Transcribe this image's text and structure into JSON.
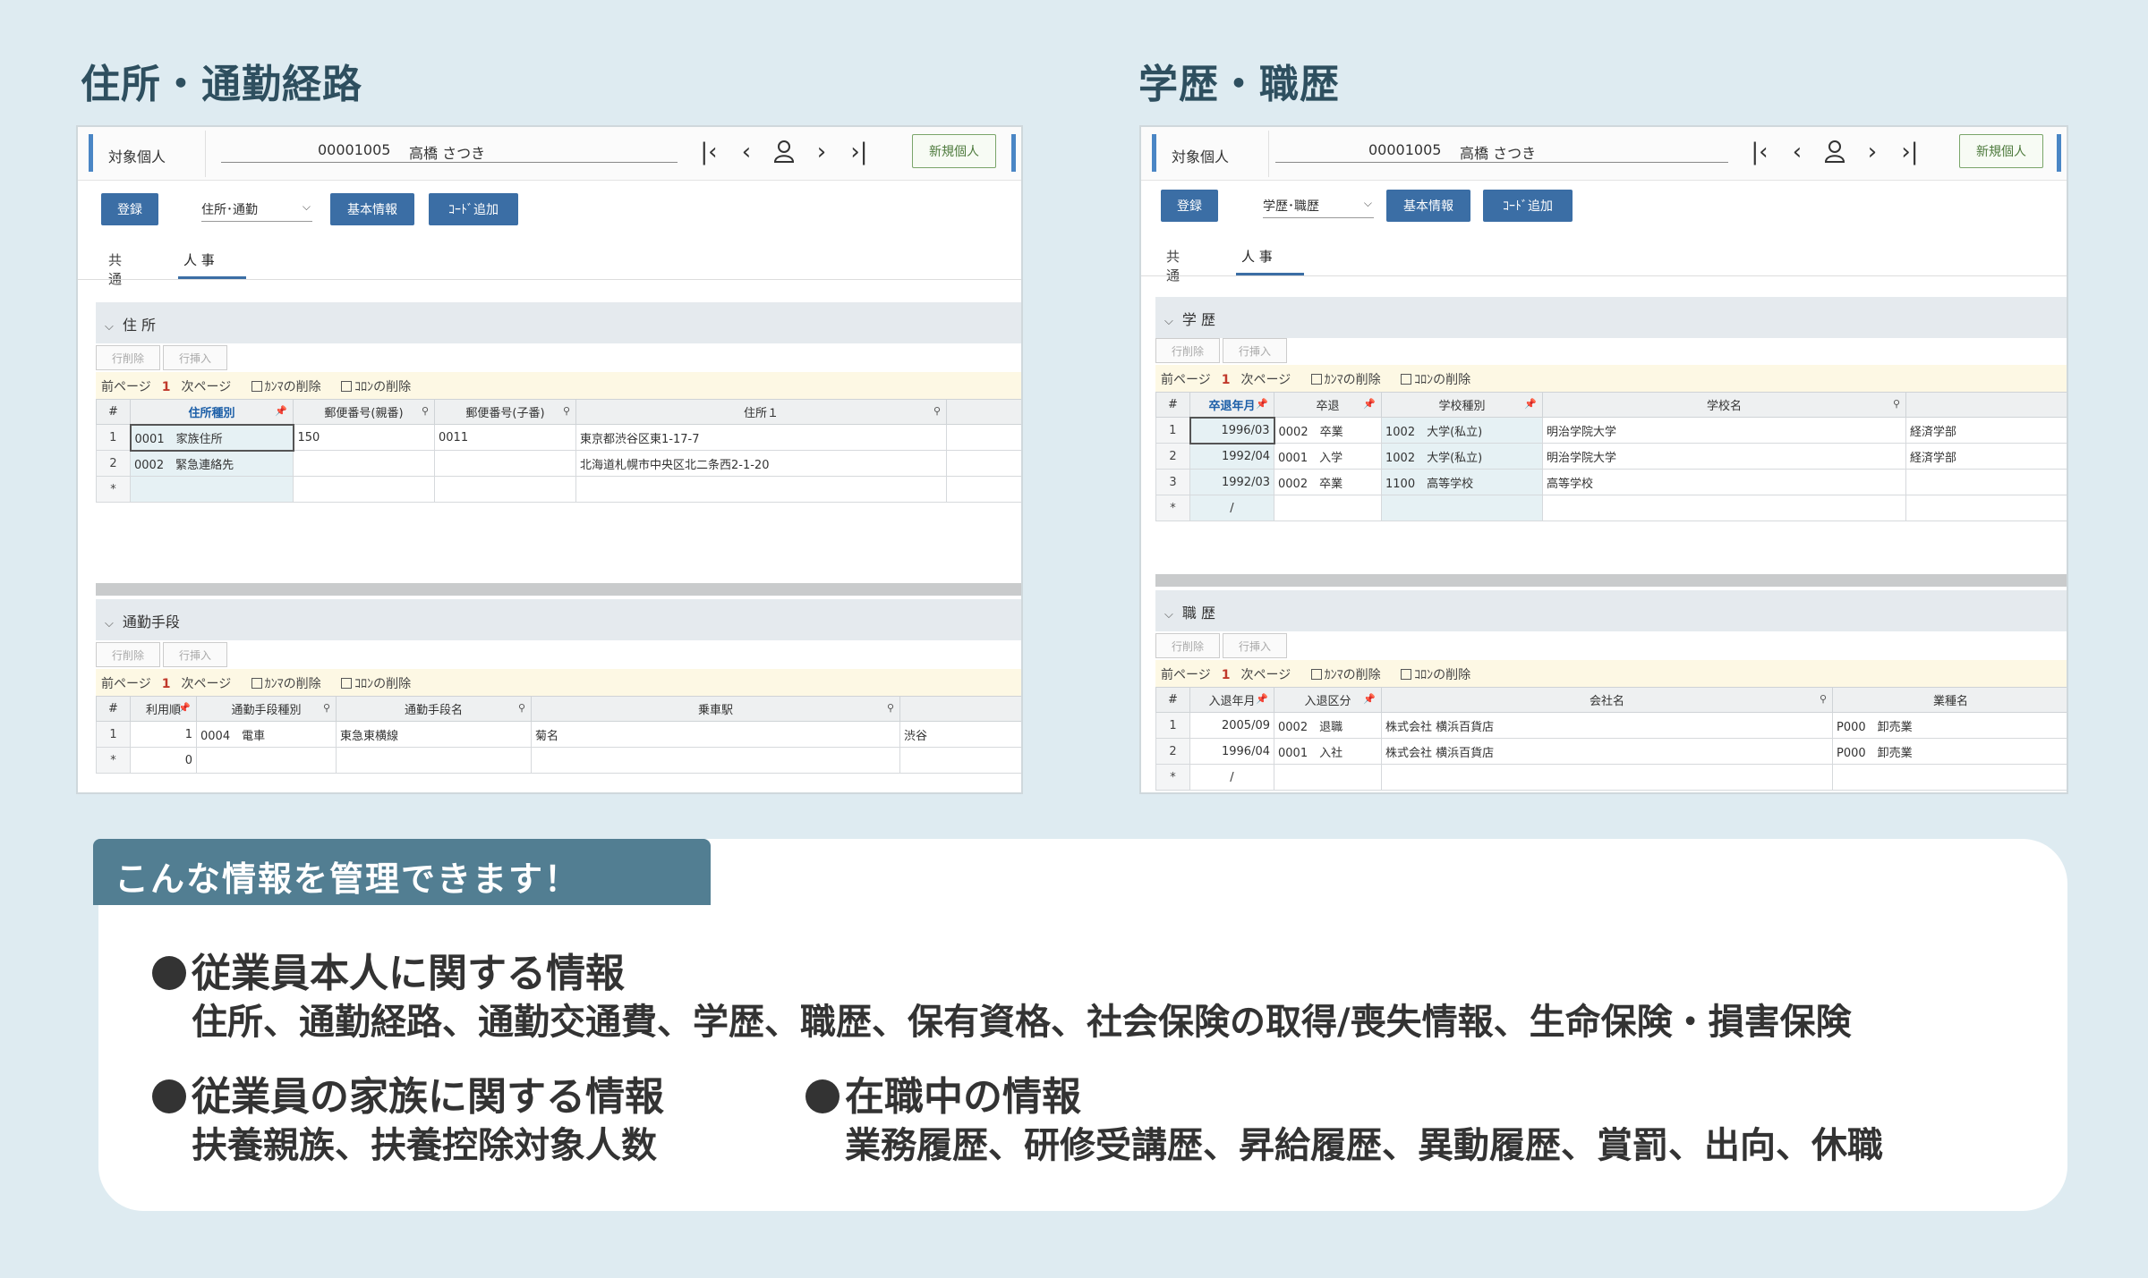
{
  "left": {
    "section_title": "住所・通勤経路",
    "header": {
      "label": "対象個人",
      "id": "00001005",
      "name": "高橋 さつき",
      "new_button": "新規個人"
    },
    "toolbar": {
      "register": "登録",
      "select_value": "住所･通勤",
      "basic_info": "基本情報",
      "add_code": "ｺｰﾄﾞ追加"
    },
    "tabs": [
      "共 通",
      "人 事"
    ],
    "address": {
      "title": "住 所",
      "buttons": [
        "行削除",
        "行挿入"
      ],
      "pager": {
        "prev": "前ページ",
        "page": "1",
        "next": "次ページ",
        "opt1": "ｶﾝﾏの削除",
        "opt2": "ｺﾛﾝの削除"
      },
      "columns": [
        "#",
        "住所種別",
        "郵便番号(親番)",
        "郵便番号(子番)",
        "住所１",
        ""
      ],
      "rows": [
        [
          "1",
          "0001　家族住所",
          "150",
          "0011",
          "東京都渋谷区東1-17-7",
          ""
        ],
        [
          "2",
          "0002　緊急連絡先",
          "",
          "",
          "北海道札幌市中央区北二条西2-1-20",
          ""
        ],
        [
          "*",
          "",
          "",
          "",
          "",
          ""
        ]
      ]
    },
    "commute": {
      "title": "通勤手段",
      "buttons": [
        "行削除",
        "行挿入"
      ],
      "pager": {
        "prev": "前ページ",
        "page": "1",
        "next": "次ページ",
        "opt1": "ｶﾝﾏの削除",
        "opt2": "ｺﾛﾝの削除"
      },
      "columns": [
        "#",
        "利用順",
        "通勤手段種別",
        "通勤手段名",
        "乗車駅",
        ""
      ],
      "rows": [
        [
          "1",
          "1",
          "0004　電車",
          "東急東横線",
          "菊名",
          "渋谷"
        ],
        [
          "*",
          "0",
          "",
          "",
          "",
          ""
        ]
      ]
    }
  },
  "right": {
    "section_title": "学歴・職歴",
    "header": {
      "label": "対象個人",
      "id": "00001005",
      "name": "高橋 さつき",
      "new_button": "新規個人"
    },
    "toolbar": {
      "register": "登録",
      "select_value": "学歴･職歴",
      "basic_info": "基本情報",
      "add_code": "ｺｰﾄﾞ追加"
    },
    "tabs": [
      "共 通",
      "人 事"
    ],
    "education": {
      "title": "学 歴",
      "buttons": [
        "行削除",
        "行挿入"
      ],
      "pager": {
        "prev": "前ページ",
        "page": "1",
        "next": "次ページ",
        "opt1": "ｶﾝﾏの削除",
        "opt2": "ｺﾛﾝの削除"
      },
      "columns": [
        "#",
        "卒退年月",
        "卒退",
        "学校種別",
        "学校名",
        ""
      ],
      "rows": [
        [
          "1",
          "1996/03",
          "0002　卒業",
          "1002　大学(私立)",
          "明治学院大学",
          "経済学部"
        ],
        [
          "2",
          "1992/04",
          "0001　入学",
          "1002　大学(私立)",
          "明治学院大学",
          "経済学部"
        ],
        [
          "3",
          "1992/03",
          "0002　卒業",
          "1100　高等学校",
          "高等学校",
          ""
        ],
        [
          "*",
          "/",
          "",
          "",
          "",
          ""
        ]
      ]
    },
    "career": {
      "title": "職 歴",
      "buttons": [
        "行削除",
        "行挿入"
      ],
      "pager": {
        "prev": "前ページ",
        "page": "1",
        "next": "次ページ",
        "opt1": "ｶﾝﾏの削除",
        "opt2": "ｺﾛﾝの削除"
      },
      "columns": [
        "#",
        "入退年月",
        "入退区分",
        "会社名",
        "業種名"
      ],
      "rows": [
        [
          "1",
          "2005/09",
          "0002　退職",
          "株式会社 横浜百貨店",
          "P000　卸売業"
        ],
        [
          "2",
          "1996/04",
          "0001　入社",
          "株式会社 横浜百貨店",
          "P000　卸売業"
        ],
        [
          "*",
          "/",
          "",
          "",
          ""
        ]
      ]
    }
  },
  "info": {
    "tag": "こんな情報を管理できます！",
    "employee_head": "従業員本人に関する情報",
    "employee_body": "住所、通勤経路、通勤交通費、学歴、職歴、保有資格、社会保険の取得/喪失情報、生命保険・損害保険",
    "family_head": "従業員の家族に関する情報",
    "family_body": "扶養親族、扶養控除対象人数",
    "work_head": "在職中の情報",
    "work_body": "業務履歴、研修受講歴、昇給履歴、異動履歴、賞罰、出向、休職"
  }
}
